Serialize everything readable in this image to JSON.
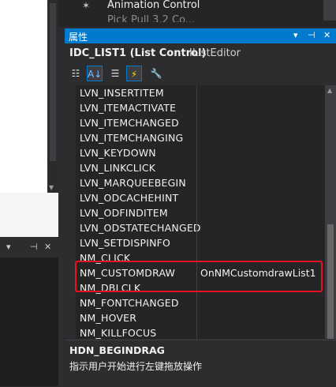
{
  "toolbox": {
    "item_label": "Animation Control",
    "item2_label": "Pick Pull 3.2 Co..."
  },
  "properties": {
    "title": "属性",
    "controls": {
      "dropdown": "▾",
      "pin": "📌",
      "close": "✕"
    },
    "object_name": "IDC_LIST1 (List Control)",
    "object_type": "IListEditor",
    "rows": [
      {
        "key": "LVN_INSERTITEM",
        "value": ""
      },
      {
        "key": "LVN_ITEMACTIVATE",
        "value": ""
      },
      {
        "key": "LVN_ITEMCHANGED",
        "value": ""
      },
      {
        "key": "LVN_ITEMCHANGING",
        "value": ""
      },
      {
        "key": "LVN_KEYDOWN",
        "value": ""
      },
      {
        "key": "LVN_LINKCLICK",
        "value": ""
      },
      {
        "key": "LVN_MARQUEEBEGIN",
        "value": ""
      },
      {
        "key": "LVN_ODCACHEHINT",
        "value": ""
      },
      {
        "key": "LVN_ODFINDITEM",
        "value": ""
      },
      {
        "key": "LVN_ODSTATECHANGED",
        "value": ""
      },
      {
        "key": "LVN_SETDISPINFO",
        "value": ""
      },
      {
        "key": "NM_CLICK",
        "value": ""
      },
      {
        "key": "NM_CUSTOMDRAW",
        "value": "OnNMCustomdrawList1"
      },
      {
        "key": "NM_DBLCLK",
        "value": ""
      },
      {
        "key": "NM_FONTCHANGED",
        "value": ""
      },
      {
        "key": "NM_HOVER",
        "value": ""
      },
      {
        "key": "NM_KILLFOCUS",
        "value": ""
      }
    ],
    "description": {
      "title": "HDN_BEGINDRAG",
      "text": "指示用户开始进行左键拖放操作"
    }
  },
  "icons": {
    "categorized": "categorized-icon",
    "alphabetical": "alphabetical-icon",
    "properties": "properties-icon",
    "events": "events-icon",
    "property_pages": "wrench-icon"
  },
  "colors": {
    "accent": "#007acc",
    "highlight_border": "#e81123",
    "background": "#2d2d30",
    "grid_background": "#252526"
  }
}
